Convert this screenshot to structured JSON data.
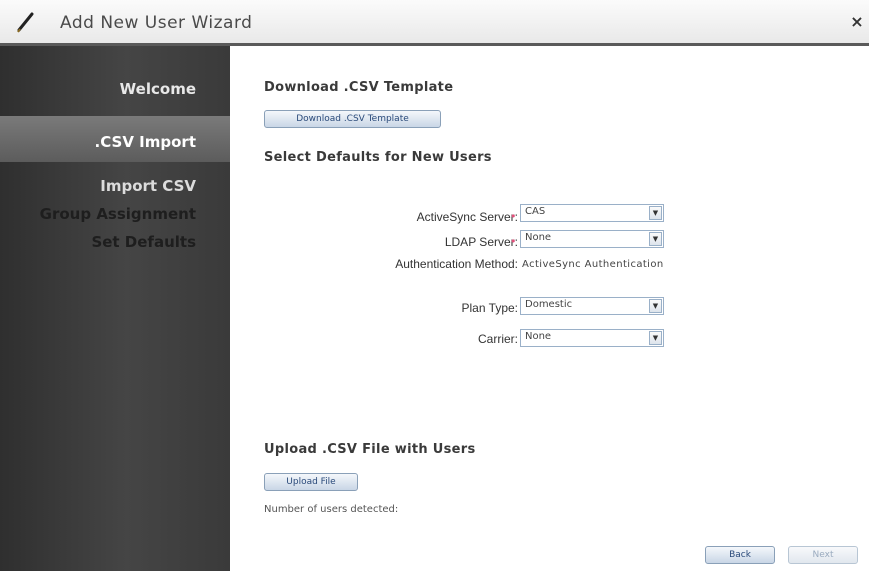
{
  "window": {
    "title": "Add New User Wizard",
    "close_label": "×"
  },
  "sidebar": {
    "items": [
      {
        "label": "Welcome",
        "state": "completed",
        "color": "#e8e8e8"
      },
      {
        "label": ".CSV Import",
        "state": "active",
        "color": "#ffffff"
      },
      {
        "label": "Import CSV",
        "state": "completed",
        "color": "#dcdcdc"
      },
      {
        "label": "Group Assignment",
        "state": "pending",
        "color": "#1e1e1e"
      },
      {
        "label": "Set Defaults",
        "state": "pending",
        "color": "#1e1e1e"
      }
    ]
  },
  "download": {
    "heading": "Download .CSV Template",
    "button_label": "Download .CSV Template"
  },
  "defaults": {
    "heading": "Select Defaults for New Users",
    "activesync_label": "ActiveSync Server:",
    "activesync_value": "CAS",
    "ldap_label": "LDAP Server:",
    "ldap_value": "None",
    "auth_label": "Authentication Method:",
    "auth_value": "ActiveSync Authentication",
    "plan_label": "Plan Type:",
    "plan_value": "Domestic",
    "carrier_label": "Carrier:",
    "carrier_value": "None",
    "required_marker": "•"
  },
  "upload": {
    "heading": "Upload .CSV File with Users",
    "button_label": "Upload File",
    "users_detected_label": "Number of users detected:"
  },
  "footer": {
    "back_label": "Back",
    "next_label": "Next"
  },
  "colors": {
    "accent_border": "#8aa0b8",
    "required": "#e0507a",
    "sidebar_bg": "#3a3a3a"
  },
  "icons": {
    "title_icon": "pencil-icon",
    "dropdown_icon": "chevron-down-icon"
  }
}
